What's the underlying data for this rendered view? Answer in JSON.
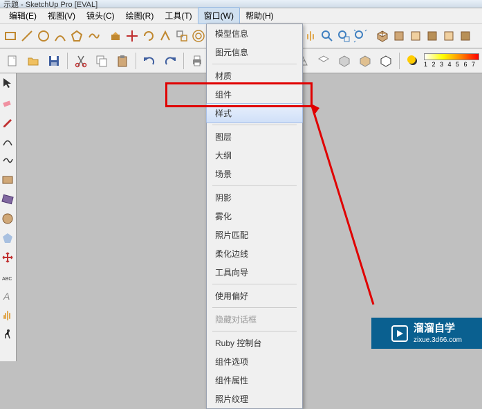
{
  "title": "示题 - SketchUp Pro [EVAL]",
  "menu": {
    "edit": "编辑(E)",
    "view": "视图(V)",
    "camera": "镜头(C)",
    "draw": "绘图(R)",
    "tools": "工具(T)",
    "window": "窗口(W)",
    "help": "帮助(H)"
  },
  "dropdown": {
    "model_info": "模型信息",
    "entity_info": "图元信息",
    "materials": "材质",
    "components": "组件",
    "styles": "样式",
    "layers": "图层",
    "outliner": "大纲",
    "scenes": "场景",
    "shadows": "阴影",
    "fog": "雾化",
    "match_photo": "照片匹配",
    "soften": "柔化边线",
    "instructor": "工具向导",
    "preferences": "使用偏好",
    "hide_dialogs": "隐藏对话框",
    "ruby_console": "Ruby 控制台",
    "component_options": "组件选项",
    "component_attributes": "组件属性",
    "photo_textures": "照片纹理"
  },
  "watermark": {
    "title": "溜溜自学",
    "url": "zixue.3d66.com"
  },
  "ruler_numbers": "1 2 3 4 5 6 7"
}
